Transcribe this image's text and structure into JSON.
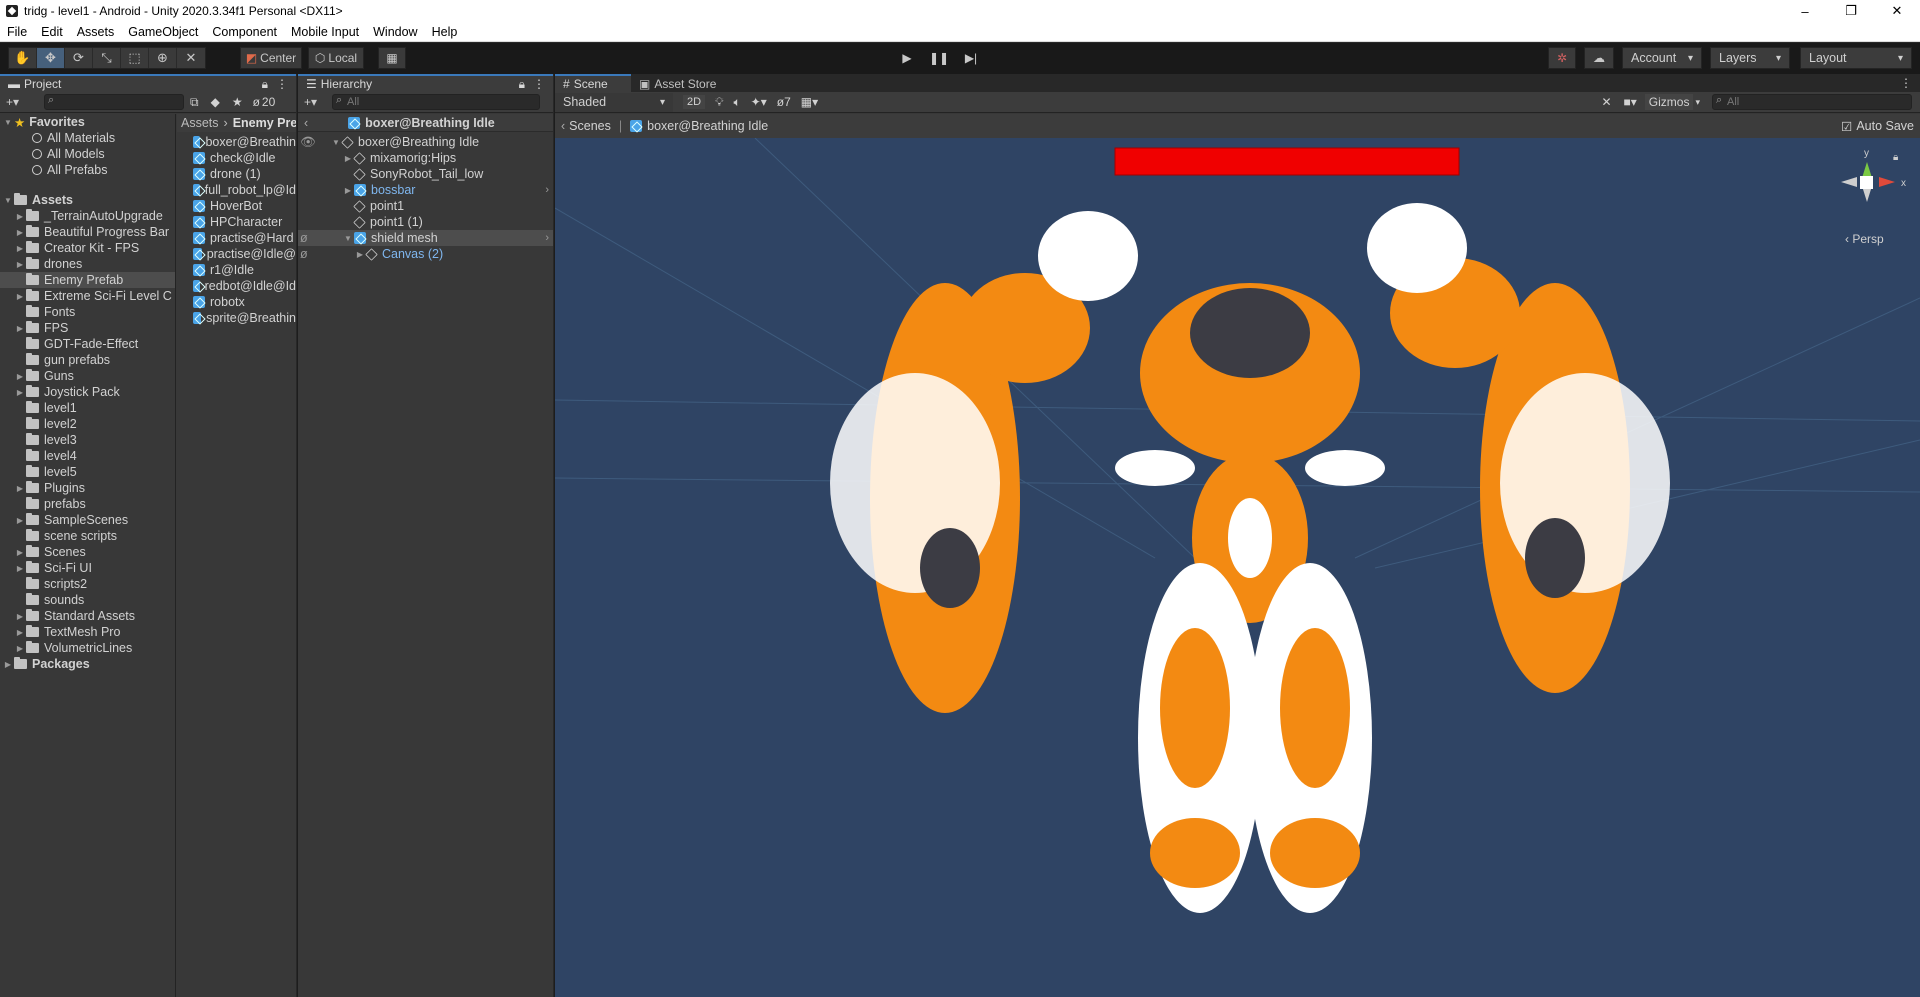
{
  "window": {
    "title": "tridg - level1 - Android - Unity 2020.3.34f1 Personal <DX11>",
    "controls": [
      "–",
      "❐",
      "✕"
    ]
  },
  "menu": [
    "File",
    "Edit",
    "Assets",
    "GameObject",
    "Component",
    "Mobile Input",
    "Window",
    "Help"
  ],
  "toolbar": {
    "pivot": "Center",
    "space": "Local",
    "account": "Account",
    "layers": "Layers",
    "layout": "Layout"
  },
  "project": {
    "tab": "Project",
    "count": "20",
    "favorites_label": "Favorites",
    "favorites": [
      "All Materials",
      "All Models",
      "All Prefabs"
    ],
    "assets_label": "Assets",
    "folders": [
      "_TerrainAutoUpgrade",
      "Beautiful Progress Bar",
      "Creator Kit - FPS",
      "drones",
      "Enemy Prefab",
      "Extreme Sci-Fi Level C",
      "Fonts",
      "FPS",
      "GDT-Fade-Effect",
      "gun prefabs",
      "Guns",
      "Joystick Pack",
      "level1",
      "level2",
      "level3",
      "level4",
      "level5",
      "Plugins",
      "prefabs",
      "SampleScenes",
      "scene scripts",
      "Scenes",
      "Sci-Fi UI",
      "scripts2",
      "sounds",
      "Standard Assets",
      "TextMesh Pro",
      "VolumetricLines"
    ],
    "packages_label": "Packages",
    "breadcrumb_root": "Assets",
    "breadcrumb_folder": "Enemy Pre",
    "files": [
      "boxer@Breathin",
      "check@Idle",
      "drone (1)",
      "full_robot_lp@Id",
      "HoverBot",
      "HPCharacter",
      "practise@Hard",
      "practise@Idle@",
      "r1@Idle",
      "redbot@Idle@Id",
      "robotx",
      "sprite@Breathin"
    ]
  },
  "hierarchy": {
    "tab": "Hierarchy",
    "search_placeholder": "All",
    "header": "boxer@Breathing Idle",
    "root": "boxer@Breathing Idle",
    "children": [
      {
        "label": "mixamorig:Hips",
        "indent": 1,
        "arrow": "▶",
        "type": "obj"
      },
      {
        "label": "SonyRobot_Tail_low",
        "indent": 1,
        "arrow": "",
        "type": "obj"
      },
      {
        "label": "bossbar",
        "indent": 1,
        "arrow": "▶",
        "type": "prefab-blue"
      },
      {
        "label": "point1",
        "indent": 1,
        "arrow": "",
        "type": "obj"
      },
      {
        "label": "point1 (1)",
        "indent": 1,
        "arrow": "",
        "type": "obj"
      },
      {
        "label": "shield mesh",
        "indent": 1,
        "arrow": "▼",
        "type": "prefab"
      },
      {
        "label": "Canvas (2)",
        "indent": 2,
        "arrow": "▶",
        "type": "obj-blue"
      }
    ]
  },
  "scene": {
    "tabs": [
      "Scene",
      "Asset Store"
    ],
    "shading": "Shaded",
    "mode2d": "2D",
    "hidden_count": "7",
    "gizmos": "Gizmos",
    "search_placeholder": "All",
    "crumb_root": "Scenes",
    "crumb_item": "boxer@Breathing Idle",
    "autosave": "Auto Save",
    "persp": "Persp",
    "axis_y": "y",
    "axis_x": "x",
    "background": "#2f4464",
    "healthbar_color": "#f00000"
  }
}
